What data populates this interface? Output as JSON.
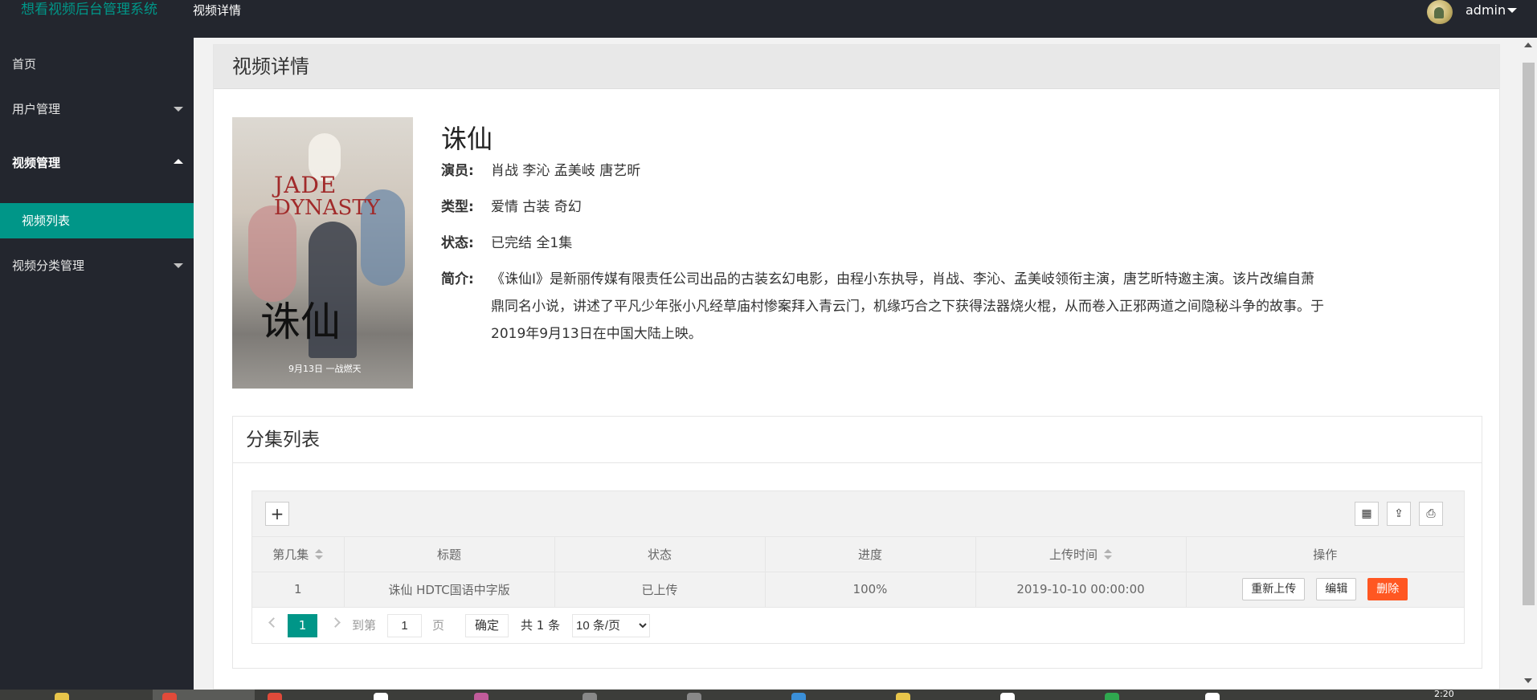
{
  "header": {
    "logo": "想看视频后台管理系统",
    "tab": "视频详情",
    "user": "admin"
  },
  "sidebar": {
    "items": [
      {
        "label": "首页"
      },
      {
        "label": "用户管理"
      },
      {
        "label": "视频管理"
      },
      {
        "label": "视频列表"
      },
      {
        "label": "视频分类管理"
      }
    ]
  },
  "main": {
    "card_title": "视频详情",
    "poster": {
      "title_line1": "JADE",
      "title_line2": "DYNASTY",
      "calligraphy": "诛仙",
      "date": "9月13日 一战燃天"
    },
    "video": {
      "title": "诛仙",
      "actors_label": "演员:",
      "actors": "肖战 李沁 孟美岐 唐艺昕",
      "type_label": "类型:",
      "type": "爱情 古装 奇幻",
      "status_label": "状态:",
      "status": "已完结 全1集",
      "intro_label": "简介:",
      "intro": "《诛仙Ⅰ》是新丽传媒有限责任公司出品的古装玄幻电影，由程小东执导，肖战、李沁、孟美岐领衔主演，唐艺昕特邀主演。该片改编自萧鼎同名小说，讲述了平凡少年张小凡经草庙村惨案拜入青云门，机缘巧合之下获得法器烧火棍，从而卷入正邪两道之间隐秘斗争的故事。于2019年9月13日在中国大陆上映。"
    },
    "episodes": {
      "title": "分集列表",
      "toolbar": {
        "add": "+",
        "columns_icon": "columns-icon",
        "export_icon": "export-icon",
        "print_icon": "print-icon"
      },
      "columns": [
        "第几集",
        "标题",
        "状态",
        "进度",
        "上传时间",
        "操作"
      ],
      "rows": [
        {
          "episode": "1",
          "title": "诛仙 HDTC国语中字版",
          "status": "已上传",
          "progress": "100%",
          "upload_time": "2019-10-10 00:00:00",
          "actions": [
            "重新上传",
            "编辑",
            "删除"
          ]
        }
      ],
      "pager": {
        "current": "1",
        "goto_label": "到第",
        "input_value": "1",
        "page_label": "页",
        "confirm": "确定",
        "total": "共 1 条",
        "page_size": "10 条/页"
      }
    }
  },
  "taskbar": {
    "clock": "2:20"
  },
  "colors": {
    "accent": "#009688",
    "danger": "#ff5722",
    "header_bg": "#23262e"
  }
}
